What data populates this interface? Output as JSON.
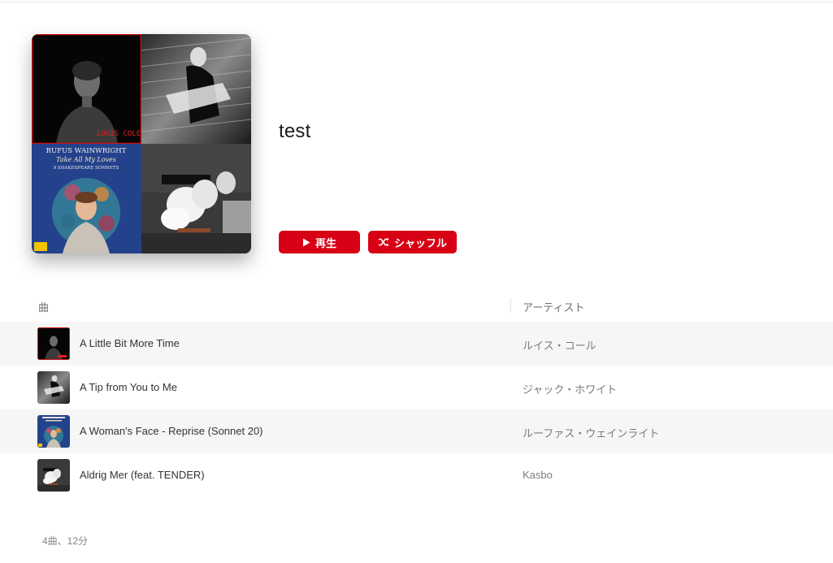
{
  "playlist": {
    "title": "test",
    "artwork_labels": {
      "tile1_brand": "LOUIS COLE",
      "tile3_line1": "RUFUS WAINWRIGHT",
      "tile3_line2": "Take All My Loves",
      "tile3_line3": "9 SHAKESPEARE SONNETS"
    }
  },
  "actions": {
    "play_label": "再生",
    "shuffle_label": "シャッフル",
    "play_icon": "play-icon",
    "shuffle_icon": "shuffle-icon"
  },
  "columns": {
    "song": "曲",
    "artist": "アーティスト"
  },
  "tracks": [
    {
      "title": "A Little Bit More Time",
      "artist": "ルイス・コール",
      "art": "louis-cole-art"
    },
    {
      "title": "A Tip from You to Me",
      "artist": "ジャック・ホワイト",
      "art": "jack-white-art"
    },
    {
      "title": "A Woman's Face - Reprise (Sonnet 20)",
      "artist": "ルーファス・ウェインライト",
      "art": "rufus-wainwright-art"
    },
    {
      "title": "Aldrig Mer (feat. TENDER)",
      "artist": "Kasbo",
      "art": "kasbo-art"
    }
  ],
  "summary": "4曲、12分",
  "colors": {
    "accent": "#d70015",
    "stripe": "#f6f6f6",
    "secondary_text": "#7a7a7f"
  }
}
